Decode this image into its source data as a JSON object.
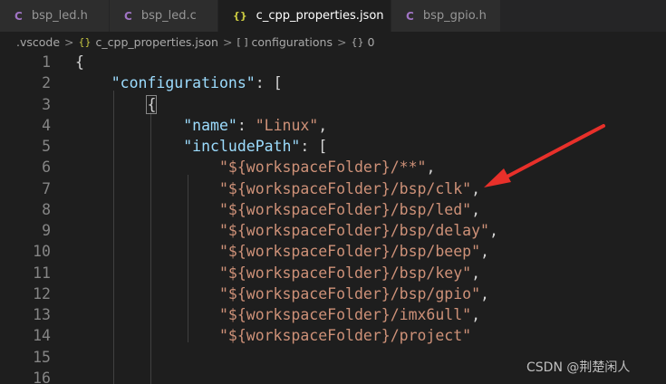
{
  "tabs": [
    {
      "icon": "C",
      "label": "bsp_led.h",
      "active": false
    },
    {
      "icon": "C",
      "label": "bsp_led.c",
      "active": false
    },
    {
      "icon": "{}",
      "label": "c_cpp_properties.json",
      "active": true,
      "close": "×"
    },
    {
      "icon": "C",
      "label": "bsp_gpio.h",
      "active": false
    }
  ],
  "breadcrumb": {
    "folder": ".vscode",
    "file_icon": "{}",
    "file": "c_cpp_properties.json",
    "array_icon": "[ ]",
    "array": "configurations",
    "object_icon": "{}",
    "object": "0",
    "separator": ">"
  },
  "lines": [
    {
      "num": "1",
      "tokens": [
        [
          "punc",
          "{"
        ]
      ]
    },
    {
      "num": "2",
      "tokens": [
        [
          "punc",
          "    "
        ],
        [
          "key",
          "\"configurations\""
        ],
        [
          "punc",
          ": ["
        ]
      ]
    },
    {
      "num": "3",
      "tokens": [
        [
          "punc",
          "        "
        ],
        [
          "brace",
          "{"
        ]
      ]
    },
    {
      "num": "4",
      "tokens": [
        [
          "punc",
          "            "
        ],
        [
          "key",
          "\"name\""
        ],
        [
          "punc",
          ": "
        ],
        [
          "str",
          "\"Linux\""
        ],
        [
          "punc",
          ","
        ]
      ]
    },
    {
      "num": "5",
      "tokens": [
        [
          "punc",
          "            "
        ],
        [
          "key",
          "\"includePath\""
        ],
        [
          "punc",
          ": ["
        ]
      ]
    },
    {
      "num": "6",
      "tokens": [
        [
          "punc",
          "                "
        ],
        [
          "str",
          "\"${workspaceFolder}/**\""
        ],
        [
          "punc",
          ","
        ]
      ]
    },
    {
      "num": "7",
      "tokens": [
        [
          "punc",
          "                "
        ],
        [
          "str",
          "\"${workspaceFolder}/bsp/clk\""
        ],
        [
          "punc",
          ","
        ]
      ]
    },
    {
      "num": "8",
      "tokens": [
        [
          "punc",
          "                "
        ],
        [
          "str",
          "\"${workspaceFolder}/bsp/led\""
        ],
        [
          "punc",
          ","
        ]
      ]
    },
    {
      "num": "9",
      "tokens": [
        [
          "punc",
          "                "
        ],
        [
          "str",
          "\"${workspaceFolder}/bsp/delay\""
        ],
        [
          "punc",
          ","
        ]
      ]
    },
    {
      "num": "10",
      "tokens": [
        [
          "punc",
          "                "
        ],
        [
          "str",
          "\"${workspaceFolder}/bsp/beep\""
        ],
        [
          "punc",
          ","
        ]
      ]
    },
    {
      "num": "11",
      "tokens": [
        [
          "punc",
          "                "
        ],
        [
          "str",
          "\"${workspaceFolder}/bsp/key\""
        ],
        [
          "punc",
          ","
        ]
      ]
    },
    {
      "num": "12",
      "tokens": [
        [
          "punc",
          "                "
        ],
        [
          "str",
          "\"${workspaceFolder}/bsp/gpio\""
        ],
        [
          "punc",
          ","
        ]
      ]
    },
    {
      "num": "13",
      "tokens": [
        [
          "punc",
          "                "
        ],
        [
          "str",
          "\"${workspaceFolder}/imx6ull\""
        ],
        [
          "punc",
          ","
        ]
      ]
    },
    {
      "num": "14",
      "tokens": [
        [
          "punc",
          "                "
        ],
        [
          "str",
          "\"${workspaceFolder}/project\""
        ]
      ]
    },
    {
      "num": "15",
      "tokens": []
    },
    {
      "num": "16",
      "tokens": []
    }
  ],
  "watermark": "CSDN @荆楚闲人",
  "colors": {
    "background": "#1e1e1e",
    "key": "#9cdcfe",
    "string": "#ce9178",
    "arrow": "#e8302a"
  }
}
